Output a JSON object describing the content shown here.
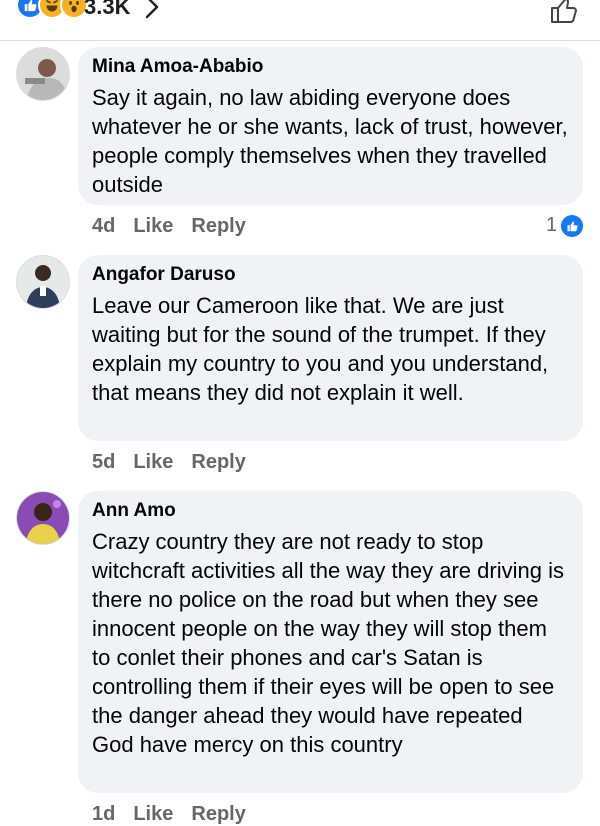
{
  "header": {
    "reactions": [
      "like-icon",
      "haha-icon",
      "wow-icon"
    ],
    "count": "3.3K",
    "colors": {
      "like": "#1877f2",
      "emoji": "#f7b125"
    }
  },
  "comments": [
    {
      "author": "Mina Amoa-Ababio",
      "text": "Say it again, no law abiding everyone does whatever he or she wants, lack of trust, however, people comply themselves when they travelled outside",
      "age": "4d",
      "like": "Like",
      "reply": "Reply",
      "reaction_count": "1"
    },
    {
      "author": "Angafor Daruso",
      "text": "Leave our Cameroon like that. We are just waiting but for the sound of the trumpet. If they explain my country to you and you understand, that means they did not explain it well.",
      "age": "5d",
      "like": "Like",
      "reply": "Reply"
    },
    {
      "author": "Ann Amo",
      "text": "Crazy country they are not ready to stop witchcraft activities all the way they are driving is there no police on the road but when they see innocent people on the way they will stop them to conlet their phones and car's Satan is controlling them if their eyes will be open to see the danger ahead they would have repeated God have mercy on this country",
      "age": "1d",
      "like": "Like",
      "reply": "Reply"
    }
  ]
}
